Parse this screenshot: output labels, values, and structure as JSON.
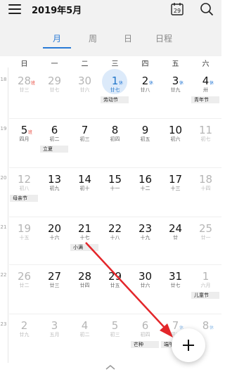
{
  "header": {
    "title": "2019年5月",
    "today_day": "29"
  },
  "tabs": [
    {
      "label": "月",
      "active": true
    },
    {
      "label": "周",
      "active": false
    },
    {
      "label": "日",
      "active": false
    },
    {
      "label": "日程",
      "active": false
    }
  ],
  "weekdays": [
    "日",
    "一",
    "二",
    "三",
    "四",
    "五",
    "六"
  ],
  "weeks": [
    {
      "week_number": "18",
      "days": [
        {
          "day": "28",
          "lunar": "廿三",
          "dim": true,
          "tag": "班",
          "tag_color": "red"
        },
        {
          "day": "29",
          "lunar": "廿七",
          "dim": true
        },
        {
          "day": "30",
          "lunar": "廿六",
          "dim": true
        },
        {
          "day": "1",
          "lunar": "廿七",
          "selected": true,
          "tag": "休",
          "tag_color": "blue",
          "event": "劳动节"
        },
        {
          "day": "2",
          "lunar": "廿八",
          "tag": "休",
          "tag_color": "blue"
        },
        {
          "day": "3",
          "lunar": "廿九",
          "tag": "休",
          "tag_color": "blue"
        },
        {
          "day": "4",
          "lunar": "卅",
          "tag": "休",
          "tag_color": "blue",
          "event": "青年节"
        }
      ]
    },
    {
      "week_number": "19",
      "days": [
        {
          "day": "5",
          "lunar": "四月",
          "tag": "班",
          "tag_color": "red"
        },
        {
          "day": "6",
          "lunar": "初二",
          "event": "立夏"
        },
        {
          "day": "7",
          "lunar": "初三"
        },
        {
          "day": "8",
          "lunar": "初四"
        },
        {
          "day": "9",
          "lunar": "初五"
        },
        {
          "day": "10",
          "lunar": "初六"
        },
        {
          "day": "11",
          "lunar": "初七",
          "dim": true
        }
      ]
    },
    {
      "week_number": "20",
      "days": [
        {
          "day": "12",
          "lunar": "初八",
          "dim": true,
          "event": "母亲节"
        },
        {
          "day": "13",
          "lunar": "初九"
        },
        {
          "day": "14",
          "lunar": "初十"
        },
        {
          "day": "15",
          "lunar": "十一"
        },
        {
          "day": "16",
          "lunar": "十二"
        },
        {
          "day": "17",
          "lunar": "十三"
        },
        {
          "day": "18",
          "lunar": "十四",
          "dim": true
        }
      ]
    },
    {
      "week_number": "21",
      "days": [
        {
          "day": "19",
          "lunar": "十五",
          "dim": true
        },
        {
          "day": "20",
          "lunar": "十六"
        },
        {
          "day": "21",
          "lunar": "十七",
          "event": "小满"
        },
        {
          "day": "22",
          "lunar": "十八"
        },
        {
          "day": "23",
          "lunar": "十九"
        },
        {
          "day": "24",
          "lunar": "廿"
        },
        {
          "day": "25",
          "lunar": "廿一",
          "dim": true
        }
      ]
    },
    {
      "week_number": "22",
      "days": [
        {
          "day": "26",
          "lunar": "廿二",
          "dim": true
        },
        {
          "day": "27",
          "lunar": "廿三"
        },
        {
          "day": "28",
          "lunar": "廿四"
        },
        {
          "day": "29",
          "lunar": "廿五"
        },
        {
          "day": "30",
          "lunar": "廿六"
        },
        {
          "day": "31",
          "lunar": "廿七"
        },
        {
          "day": "1",
          "lunar": "六月",
          "dim": true,
          "event": "儿童节"
        }
      ]
    },
    {
      "week_number": "23",
      "days": [
        {
          "day": "2",
          "lunar": "廿九",
          "dim": true
        },
        {
          "day": "3",
          "lunar": "五月",
          "dim": true
        },
        {
          "day": "4",
          "lunar": "初二",
          "dim": true
        },
        {
          "day": "5",
          "lunar": "初三",
          "dim": true
        },
        {
          "day": "6",
          "lunar": "初四",
          "dim": true,
          "event": "芒种"
        },
        {
          "day": "7",
          "lunar": "初五",
          "dim": true,
          "tag": "休",
          "tag_color": "light",
          "event": "端午节"
        },
        {
          "day": "8",
          "lunar": "",
          "dim": true,
          "tag": "休",
          "tag_color": "light"
        }
      ]
    }
  ],
  "colors": {
    "accent": "#2a7bd6",
    "selected_bg": "#dceafa",
    "holiday_work": "#e8473b",
    "arrow": "#e3262a"
  },
  "icons": {
    "menu": "menu-icon",
    "today": "calendar-today-icon",
    "search": "search-icon",
    "add": "plus-icon",
    "expand": "chevron-up-icon"
  }
}
